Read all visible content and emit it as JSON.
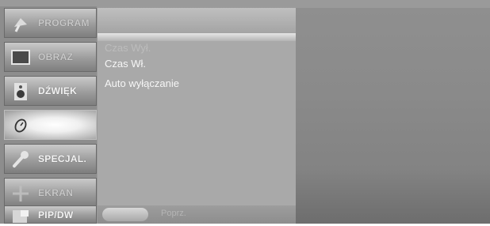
{
  "sidebar": {
    "items": [
      {
        "label": "PROGRAM",
        "icon": "satellite-dish-icon"
      },
      {
        "label": "OBRAZ",
        "icon": "screen-icon"
      },
      {
        "label": "DŹWIĘK",
        "icon": "speaker-icon"
      },
      {
        "label": "",
        "icon": "clock-icon",
        "selected": true
      },
      {
        "label": "SPECJAL.",
        "icon": "wrench-icon"
      },
      {
        "label": "EKRAN",
        "icon": "cross-arrows-icon"
      },
      {
        "label": "PIP/DW",
        "icon": "pip-icon"
      }
    ]
  },
  "submenu": {
    "items": [
      {
        "label": "Czas Wył."
      },
      {
        "label": "Czas Wł."
      },
      {
        "label": "Auto wyłączanie"
      }
    ]
  },
  "footer": {
    "label": "Poprz."
  },
  "colors": {
    "background": "#9a9a9a",
    "panel": "#a9a9a9",
    "text": "#f6f6f6"
  }
}
